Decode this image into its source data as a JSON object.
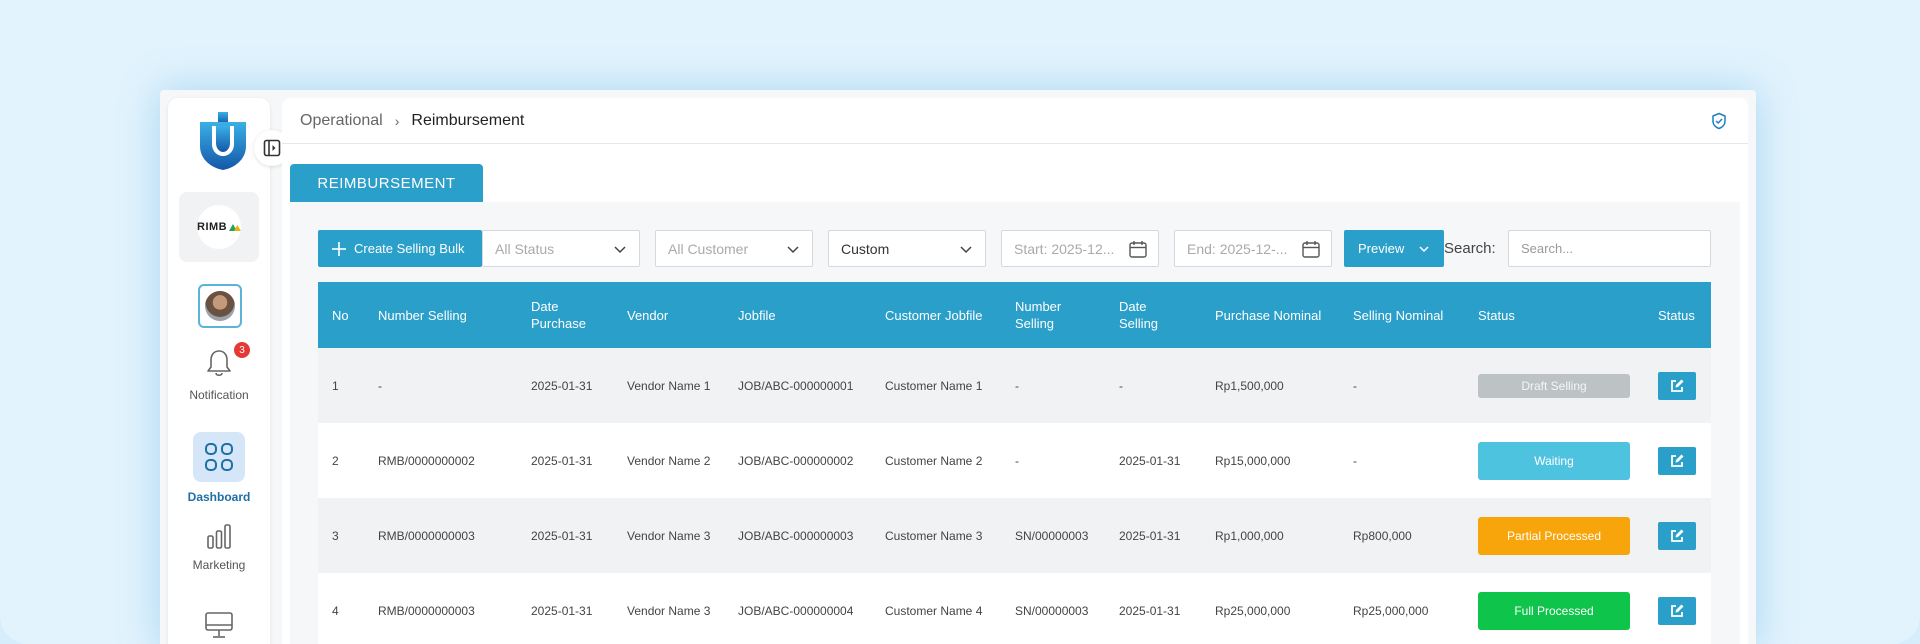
{
  "sidebar": {
    "company_logo_text": "RIMB",
    "notification_count": "3",
    "items": [
      {
        "label": "Notification",
        "icon": "bell-icon"
      },
      {
        "label": "Dashboard",
        "icon": "grid-icon"
      },
      {
        "label": "Marketing",
        "icon": "bar-chart-icon"
      },
      {
        "label": "",
        "icon": "monitor-icon"
      }
    ]
  },
  "breadcrumb": {
    "root": "Operational",
    "separator": "›",
    "current": "Reimbursement"
  },
  "tab": {
    "label": "REIMBURSEMENT"
  },
  "toolbar": {
    "create_label": "Create Selling Bulk",
    "status_filter": "All Status",
    "customer_filter": "All Customer",
    "period_filter": "Custom",
    "start_date_placeholder": "Start: 2025-12...",
    "end_date_placeholder": "End: 2025-12-...",
    "preview_label": "Preview",
    "search_label": "Search:",
    "search_placeholder": "Search..."
  },
  "table": {
    "headers": {
      "no": "No",
      "number_selling": "Number Selling",
      "date_purchase_1": "Date",
      "date_purchase_2": "Purchase",
      "vendor": "Vendor",
      "jobfile": "Jobfile",
      "customer_jobfile": "Customer Jobfile",
      "number_selling2_1": "Number",
      "number_selling2_2": "Selling",
      "date_selling_1": "Date",
      "date_selling_2": "Selling",
      "purchase_nominal": "Purchase Nominal",
      "selling_nominal": "Selling Nominal",
      "status": "Status",
      "status_action": "Status"
    },
    "rows": [
      {
        "no": "1",
        "number_selling": "-",
        "date_purchase": "2025-01-31",
        "vendor": "Vendor Name 1",
        "jobfile": "JOB/ABC-000000001",
        "customer": "Customer Name 1",
        "number_selling2": "-",
        "date_selling": "-",
        "purchase_nominal": "Rp1,500,000",
        "selling_nominal": "-",
        "status": "Draft Selling",
        "status_color": "#bdc2c4"
      },
      {
        "no": "2",
        "number_selling": "RMB/0000000002",
        "date_purchase": "2025-01-31",
        "vendor": "Vendor Name 2",
        "jobfile": "JOB/ABC-000000002",
        "customer": "Customer Name 2",
        "number_selling2": "-",
        "date_selling": "2025-01-31",
        "purchase_nominal": "Rp15,000,000",
        "selling_nominal": "-",
        "status": "Waiting",
        "status_color": "#4ec3e0"
      },
      {
        "no": "3",
        "number_selling": "RMB/0000000003",
        "date_purchase": "2025-01-31",
        "vendor": "Vendor Name 3",
        "jobfile": "JOB/ABC-000000003",
        "customer": "Customer Name 3",
        "number_selling2": "SN/00000003",
        "date_selling": "2025-01-31",
        "purchase_nominal": "Rp1,000,000",
        "selling_nominal": "Rp800,000",
        "status": "Partial Processed",
        "status_color": "#f7a50a"
      },
      {
        "no": "4",
        "number_selling": "RMB/0000000003",
        "date_purchase": "2025-01-31",
        "vendor": "Vendor Name 3",
        "jobfile": "JOB/ABC-000000004",
        "customer": "Customer Name 4",
        "number_selling2": "SN/00000003",
        "date_selling": "2025-01-31",
        "purchase_nominal": "Rp25,000,000",
        "selling_nominal": "Rp25,000,000",
        "status": "Full Processed",
        "status_color": "#0fc44a"
      }
    ]
  },
  "colors": {
    "accent": "#2a9fca",
    "logo_blue": "#1d8fd0"
  }
}
